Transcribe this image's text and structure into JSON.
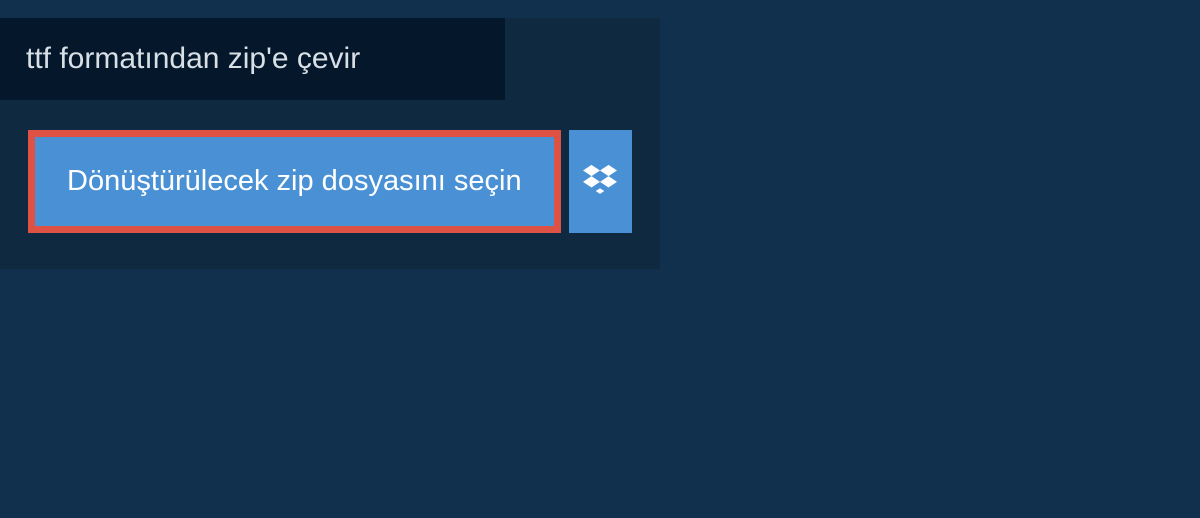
{
  "title": "ttf formatından zip'e çevir",
  "select_button_label": "Dönüştürülecek zip dosyasını seçin"
}
